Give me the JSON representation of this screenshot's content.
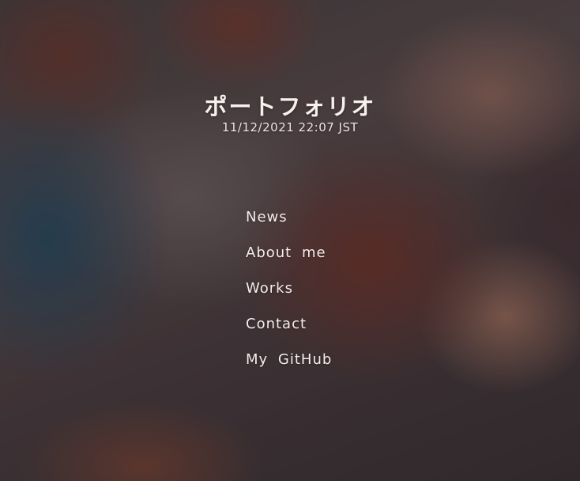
{
  "header": {
    "title": "ポートフォリオ",
    "datetime": "11/12/2021 22:07 JST"
  },
  "nav": {
    "items": [
      {
        "label": "News"
      },
      {
        "label": "About me"
      },
      {
        "label": "Works"
      },
      {
        "label": "Contact"
      },
      {
        "label": "My GitHub"
      }
    ]
  },
  "theme": {
    "text_color": "#f2ecea",
    "overlay_color": "#3a3134"
  }
}
